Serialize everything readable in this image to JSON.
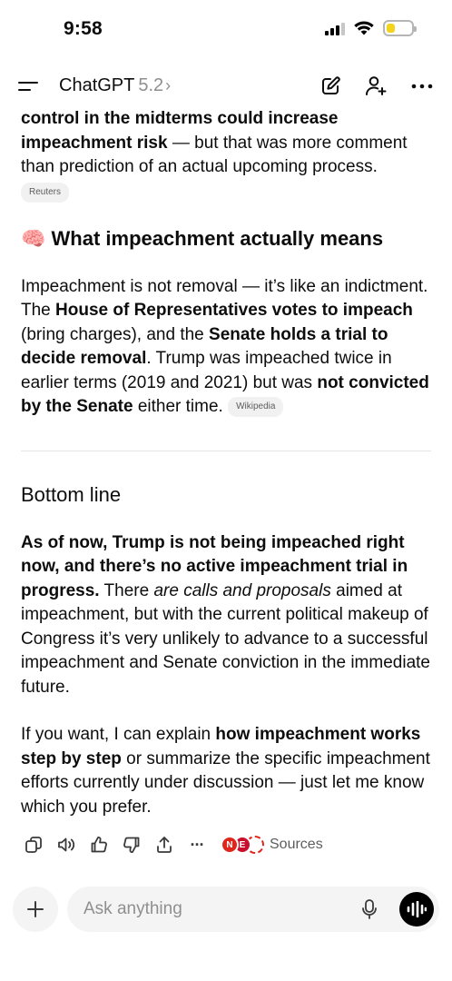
{
  "status_bar": {
    "time": "9:58",
    "battery_level": 0.35,
    "battery_color": "#f4d31c",
    "icons": [
      "cellular-signal-icon",
      "wifi-icon",
      "battery-icon"
    ]
  },
  "header": {
    "title": "ChatGPT",
    "version": "5.2",
    "chevron": "›",
    "icons": [
      "menu-icon",
      "new-chat-icon",
      "add-person-icon",
      "more-icon"
    ]
  },
  "message": {
    "p1": {
      "b1": "control in the midterms could increase impeachment risk",
      "t1": " — but that was more comment than prediction of an actual upcoming process."
    },
    "chip_reuters": "Reuters",
    "section1_emoji": "🧠",
    "section1_title": "What impeachment actually means",
    "p2": {
      "t1": "Impeachment is not removal — it’s like an indictment. The ",
      "b1": "House of Representatives votes to impeach",
      "t2": " (bring charges), and the ",
      "b2": "Senate holds a trial to decide removal",
      "t3": ". Trump was impeached twice in earlier terms (2019 and 2021) but was ",
      "b3": "not convicted by the Senate",
      "t4": " either time. "
    },
    "chip_wikipedia": "Wikipedia",
    "section2_title": "Bottom line",
    "p3": {
      "b1": "As of now, Trump is not being impeached right now, and there’s no active impeachment trial in progress.",
      "t1": " There ",
      "i1": "are calls and proposals",
      "t2": " aimed at impeachment, but with the current political makeup of Congress it’s very unlikely to advance to a successful impeachment and Senate conviction in the immediate future."
    },
    "p4": {
      "t1": "If you want, I can explain ",
      "b1": "how impeachment works step by step",
      "t2": " or summarize the specific impeachment efforts currently under discussion — just let me know which you prefer."
    }
  },
  "actions": {
    "icons": [
      "copy-icon",
      "read-aloud-icon",
      "thumbs-up-icon",
      "thumbs-down-icon",
      "share-icon",
      "more-icon"
    ],
    "more_label": "···",
    "sources_label": "Sources",
    "source_logos": [
      "N",
      "E",
      ""
    ],
    "source_colors": [
      "#e0261c",
      "#c8102e",
      "#ffffff"
    ]
  },
  "composer": {
    "placeholder": "Ask anything",
    "plus": "+"
  }
}
